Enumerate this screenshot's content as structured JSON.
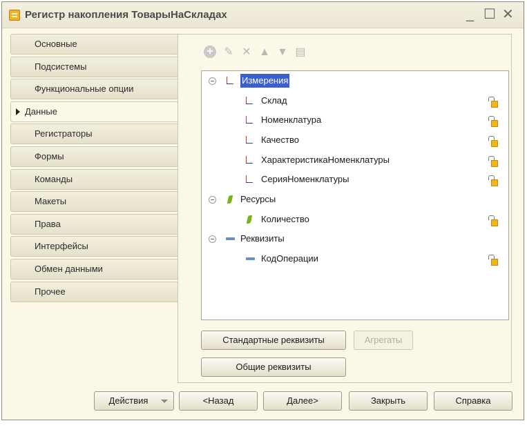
{
  "window": {
    "title": "Регистр накопления ТоварыНаСкладах"
  },
  "tabs": [
    {
      "label": "Основные"
    },
    {
      "label": "Подсистемы"
    },
    {
      "label": "Функциональные опции"
    },
    {
      "label": "Данные",
      "active": true
    },
    {
      "label": "Регистраторы"
    },
    {
      "label": "Формы"
    },
    {
      "label": "Команды"
    },
    {
      "label": "Макеты"
    },
    {
      "label": "Права"
    },
    {
      "label": "Интерфейсы"
    },
    {
      "label": "Обмен данными"
    },
    {
      "label": "Прочее"
    }
  ],
  "toolbar": {
    "icons": [
      "add-icon",
      "edit-icon",
      "delete-icon",
      "move-up-icon",
      "move-down-icon",
      "list-icon"
    ]
  },
  "tree": {
    "groups": [
      {
        "label": "Измерения",
        "icon": "dimension-icon",
        "selected": true,
        "children": [
          "Склад",
          "Номенклатура",
          "Качество",
          "ХарактеристикаНоменклатуры",
          "СерияНоменклатуры"
        ]
      },
      {
        "label": "Ресурсы",
        "icon": "resource-icon",
        "children": [
          "Количество"
        ]
      },
      {
        "label": "Реквизиты",
        "icon": "attribute-icon",
        "children": [
          "КодОперации"
        ]
      }
    ]
  },
  "panel_buttons": {
    "standard_attributes": "Стандартные реквизиты",
    "aggregates": "Агрегаты",
    "common_attributes": "Общие реквизиты"
  },
  "footer": {
    "actions": "Действия",
    "back": "<Назад",
    "next": "Далее>",
    "close": "Закрыть",
    "help": "Справка"
  },
  "colors": {
    "window_bg": "#fbf8e8",
    "selection": "#3b5fd0",
    "dimension_red": "#c0392b",
    "resource_green": "#7ab317",
    "attribute_blue": "#6a8fc2"
  }
}
